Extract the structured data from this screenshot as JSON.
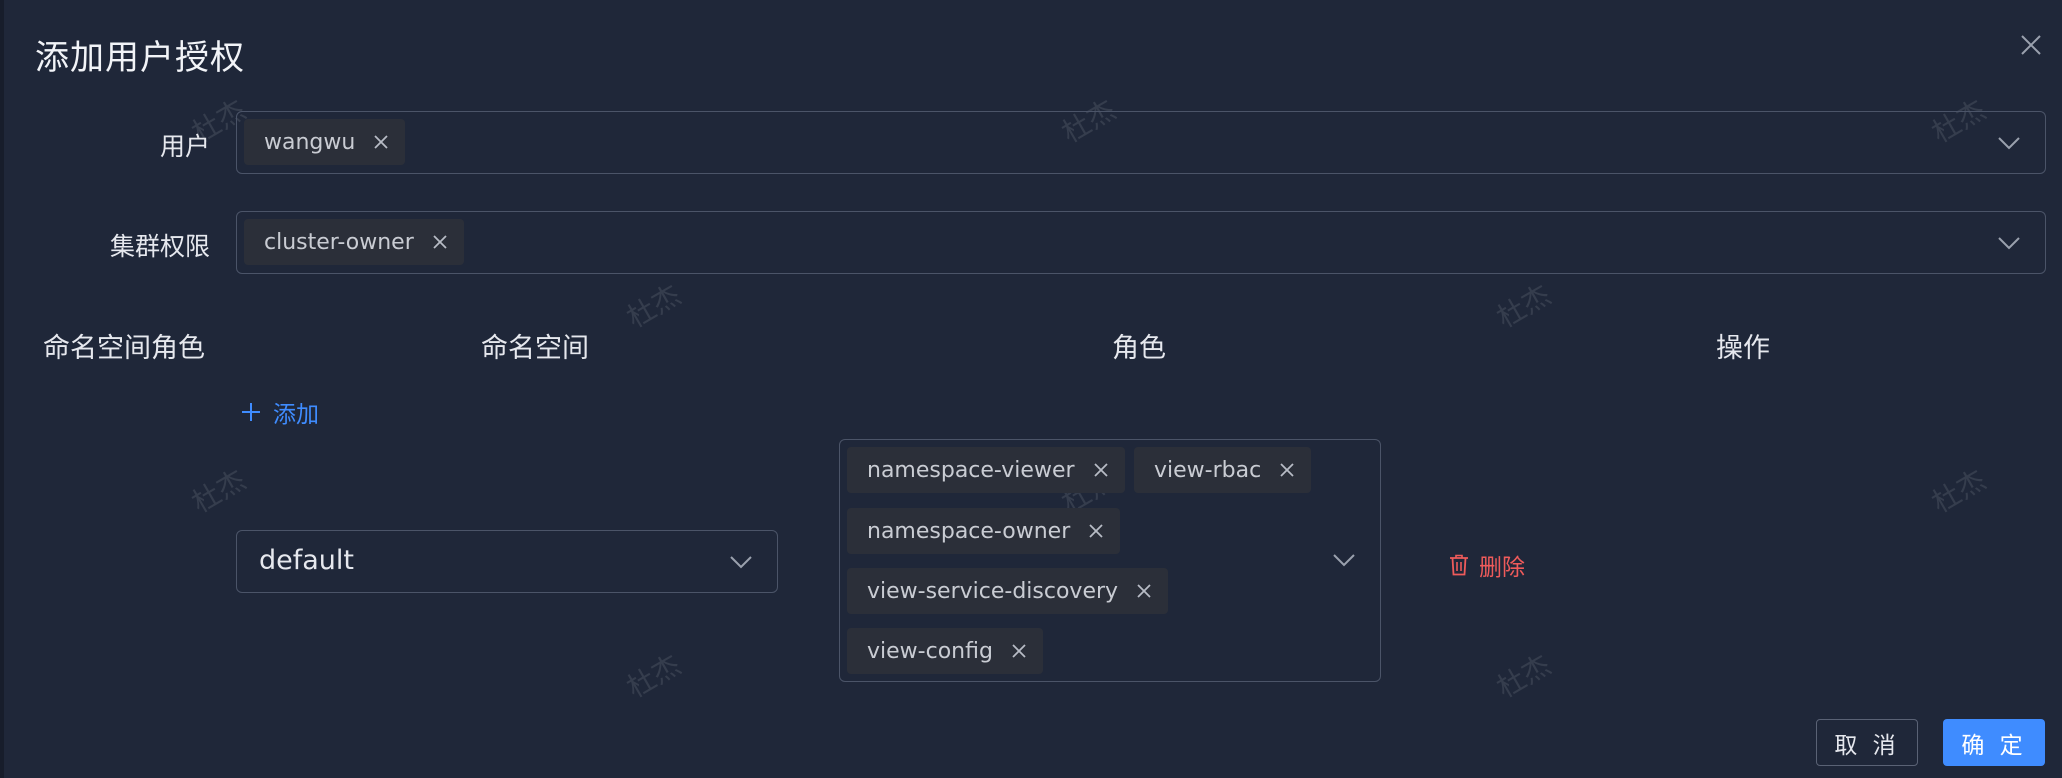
{
  "dialog": {
    "title": "添加用户授权"
  },
  "form": {
    "user": {
      "label": "用户",
      "tags": [
        "wangwu"
      ]
    },
    "cluster_permission": {
      "label": "集群权限",
      "tags": [
        "cluster-owner"
      ]
    }
  },
  "namespace_roles": {
    "section_label": "命名空间角色",
    "columns": {
      "namespace": "命名空间",
      "role": "角色",
      "operation": "操作"
    },
    "add_label": "添加",
    "rows": [
      {
        "namespace": "default",
        "roles": [
          "namespace-viewer",
          "view-rbac",
          "namespace-owner",
          "view-service-discovery",
          "view-config"
        ],
        "delete_label": "删除"
      }
    ]
  },
  "footer": {
    "cancel_label": "取 消",
    "ok_label": "确 定"
  },
  "watermark": {
    "text": "杜杰"
  },
  "colors": {
    "background": "#1f2739",
    "accent": "#3f8cff",
    "danger": "#ef5b5b",
    "tag_bg": "#2b2f39",
    "border": "#4b5468"
  },
  "icons": {
    "close": "close-icon",
    "tag_remove": "close-icon",
    "dropdown": "chevron-down-icon",
    "add": "plus-icon",
    "delete": "trash-icon"
  }
}
